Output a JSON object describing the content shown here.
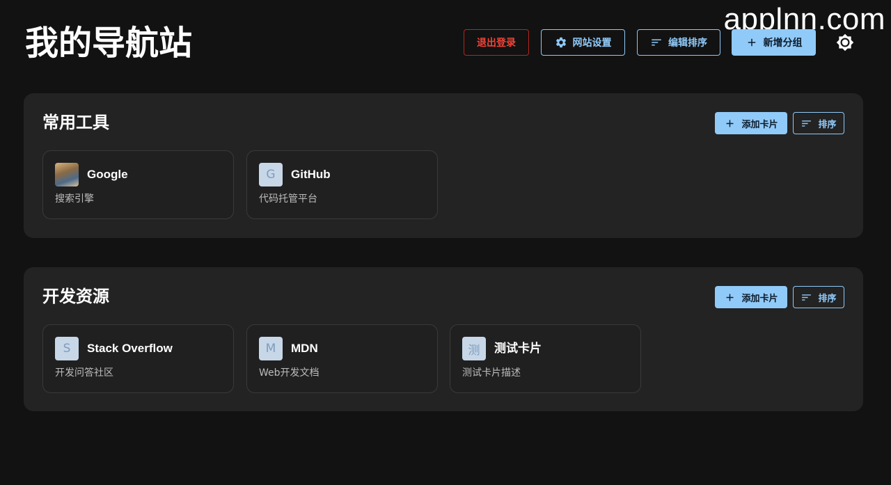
{
  "watermark": "applnn.com",
  "header": {
    "title": "我的导航站",
    "logout_label": "退出登录",
    "site_settings_label": "网站设置",
    "edit_sort_label": "编辑排序",
    "add_group_label": "新增分组",
    "theme_toggle_icon": "sun-icon"
  },
  "colors": {
    "accent": "#90caf9",
    "danger": "#f44336",
    "background": "#121212",
    "panel": "#232323"
  },
  "groups": [
    {
      "title": "常用工具",
      "add_card_label": "添加卡片",
      "sort_label": "排序",
      "cards": [
        {
          "icon_type": "image",
          "icon_letter": "",
          "title": "Google",
          "description": "搜索引擎"
        },
        {
          "icon_type": "letter",
          "icon_letter": "G",
          "title": "GitHub",
          "description": "代码托管平台"
        }
      ]
    },
    {
      "title": "开发资源",
      "add_card_label": "添加卡片",
      "sort_label": "排序",
      "cards": [
        {
          "icon_type": "letter",
          "icon_letter": "S",
          "title": "Stack Overflow",
          "description": "开发问答社区"
        },
        {
          "icon_type": "letter",
          "icon_letter": "M",
          "title": "MDN",
          "description": "Web开发文档"
        },
        {
          "icon_type": "letter",
          "icon_letter": "测",
          "title": "测试卡片",
          "description": "测试卡片描述"
        }
      ]
    }
  ]
}
